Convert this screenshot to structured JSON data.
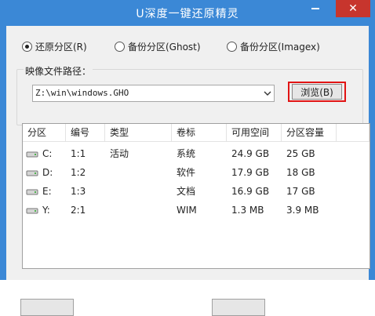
{
  "window": {
    "title": "U深度一键还原精灵"
  },
  "modes": [
    {
      "label": "还原分区(R)",
      "selected": true
    },
    {
      "label": "备份分区(Ghost)",
      "selected": false
    },
    {
      "label": "备份分区(Imagex)",
      "selected": false
    }
  ],
  "image_path": {
    "label": "映像文件路径：",
    "value": "Z:\\win\\windows.GHO"
  },
  "browse": {
    "label": "浏览(B)"
  },
  "table": {
    "headers": [
      "分区",
      "编号",
      "类型",
      "卷标",
      "可用空间",
      "分区容量"
    ],
    "rows": [
      {
        "drive": "C:",
        "number": "1:1",
        "type": "活动",
        "label": "系统",
        "free": "24.9 GB",
        "size": "25 GB"
      },
      {
        "drive": "D:",
        "number": "1:2",
        "type": "",
        "label": "软件",
        "free": "17.9 GB",
        "size": "18 GB"
      },
      {
        "drive": "E:",
        "number": "1:3",
        "type": "",
        "label": "文档",
        "free": "16.9 GB",
        "size": "17 GB"
      },
      {
        "drive": "Y:",
        "number": "2:1",
        "type": "",
        "label": "WIM",
        "free": "1.3 MB",
        "size": "3.9 MB"
      }
    ]
  },
  "colors": {
    "titlebar": "#3b88d6",
    "close": "#c7352d",
    "highlight": "#e11414"
  }
}
